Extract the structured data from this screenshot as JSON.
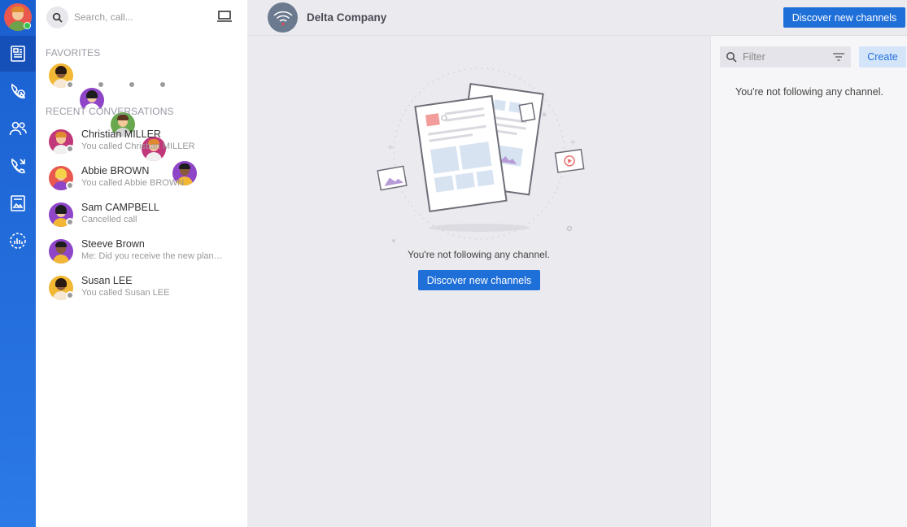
{
  "search": {
    "placeholder": "Search, call..."
  },
  "favorites": {
    "title": "FAVORITES"
  },
  "recent": {
    "title": "RECENT CONVERSATIONS",
    "items": [
      {
        "name": "Christian MILLER",
        "sub": "You called Christian MILLER"
      },
      {
        "name": "Abbie BROWN",
        "sub": "You called Abbie BROWN"
      },
      {
        "name": "Sam CAMPBELL",
        "sub": "Cancelled call"
      },
      {
        "name": "Steeve Brown",
        "sub": "Me: Did you receive the new plan…"
      },
      {
        "name": "Susan LEE",
        "sub": "You called Susan LEE"
      }
    ]
  },
  "header": {
    "company": "Delta Company",
    "discover_label": "Discover new channels"
  },
  "center": {
    "empty_text": "You're not following any channel.",
    "discover_label": "Discover new channels"
  },
  "right": {
    "filter_placeholder": "Filter",
    "create_label": "Create",
    "empty_text": "You're not following any channel."
  },
  "colors": {
    "accent": "#1f6fd9",
    "rail": "#1a5fd0",
    "online": "#35c34b",
    "offline": "#9b9b9b"
  },
  "icons": {
    "rail": [
      "news-icon",
      "calls-icon",
      "contacts-icon",
      "call-log-icon",
      "files-icon",
      "stats-icon"
    ]
  }
}
